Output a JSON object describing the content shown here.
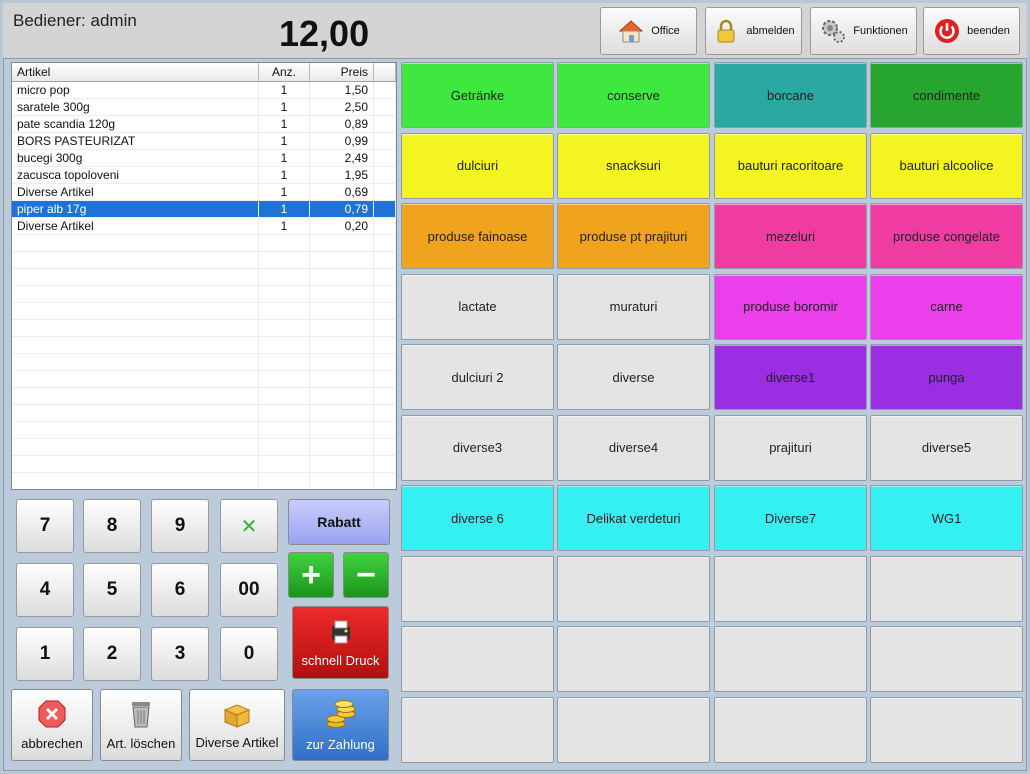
{
  "header": {
    "operator": "Bediener: admin",
    "total": "12,00",
    "buttons": {
      "office": "Office",
      "logout": "abmelden",
      "functions": "Funktionen",
      "exit": "beenden"
    }
  },
  "table": {
    "columns": [
      "Artikel",
      "Anz.",
      "Preis"
    ],
    "rows": [
      {
        "name": "micro pop",
        "qty": "1",
        "price": "1,50"
      },
      {
        "name": "saratele 300g",
        "qty": "1",
        "price": "2,50"
      },
      {
        "name": "pate scandia 120g",
        "qty": "1",
        "price": "0,89"
      },
      {
        "name": "BORS PASTEURIZAT",
        "qty": "1",
        "price": "0,99"
      },
      {
        "name": "bucegi 300g",
        "qty": "1",
        "price": "2,49"
      },
      {
        "name": "zacusca topoloveni",
        "qty": "1",
        "price": "1,95"
      },
      {
        "name": "Diverse Artikel",
        "qty": "1",
        "price": "0,69"
      },
      {
        "name": "piper alb 17g",
        "qty": "1",
        "price": "0,79"
      },
      {
        "name": "Diverse Artikel",
        "qty": "1",
        "price": "0,20"
      }
    ],
    "selected_index": 7
  },
  "keypad": {
    "keys": [
      "7",
      "8",
      "9",
      "4",
      "5",
      "6",
      "00",
      "1",
      "2",
      "3",
      "0"
    ],
    "clear_symbol": "✕"
  },
  "actions": {
    "rabatt": "Rabatt",
    "plus": "+",
    "minus": "−",
    "print": "schnell Druck",
    "cancel": "abbrechen",
    "delete": "Art. löschen",
    "misc": "Diverse Artikel",
    "pay": "zur Zahlung"
  },
  "categories": [
    {
      "label": "Getränke",
      "color": "#3fe83f"
    },
    {
      "label": "conserve",
      "color": "#3fe83f"
    },
    {
      "label": "borcane",
      "color": "#2aa8a1"
    },
    {
      "label": "condimente",
      "color": "#27a62f"
    },
    {
      "label": "dulciuri",
      "color": "#f4f423"
    },
    {
      "label": "snacksuri",
      "color": "#f4f423"
    },
    {
      "label": "bauturi racoritoare",
      "color": "#f4f423"
    },
    {
      "label": "bauturi alcoolice",
      "color": "#f4f423"
    },
    {
      "label": "produse fainoase",
      "color": "#f0a31d"
    },
    {
      "label": "produse pt prajituri",
      "color": "#f0a31d"
    },
    {
      "label": "mezeluri",
      "color": "#f03ba3"
    },
    {
      "label": "produse congelate",
      "color": "#f03ba3"
    },
    {
      "label": "lactate",
      "color": "#e4e4e4"
    },
    {
      "label": "muraturi",
      "color": "#e4e4e4"
    },
    {
      "label": "produse boromir",
      "color": "#ec3fec"
    },
    {
      "label": "carne",
      "color": "#ec3fec"
    },
    {
      "label": "dulciuri 2",
      "color": "#e4e4e4"
    },
    {
      "label": "diverse",
      "color": "#e4e4e4"
    },
    {
      "label": "diverse1",
      "color": "#9b2ee3"
    },
    {
      "label": "punga",
      "color": "#9b2ee3"
    },
    {
      "label": "diverse3",
      "color": "#e4e4e4"
    },
    {
      "label": "diverse4",
      "color": "#e4e4e4"
    },
    {
      "label": "prajituri",
      "color": "#e4e4e4"
    },
    {
      "label": "diverse5",
      "color": "#e4e4e4"
    },
    {
      "label": "diverse 6",
      "color": "#35f0f0"
    },
    {
      "label": "Delikat verdeturi",
      "color": "#35f0f0"
    },
    {
      "label": "Diverse7",
      "color": "#35f0f0"
    },
    {
      "label": "WG1",
      "color": "#35f0f0"
    },
    {
      "label": "",
      "color": "#e4e4e4"
    },
    {
      "label": "",
      "color": "#e4e4e4"
    },
    {
      "label": "",
      "color": "#e4e4e4"
    },
    {
      "label": "",
      "color": "#e4e4e4"
    },
    {
      "label": "",
      "color": "#e4e4e4"
    },
    {
      "label": "",
      "color": "#e4e4e4"
    },
    {
      "label": "",
      "color": "#e4e4e4"
    },
    {
      "label": "",
      "color": "#e4e4e4"
    },
    {
      "label": "",
      "color": "#e4e4e4"
    },
    {
      "label": "",
      "color": "#e4e4e4"
    },
    {
      "label": "",
      "color": "#e4e4e4"
    },
    {
      "label": "",
      "color": "#e4e4e4"
    }
  ]
}
